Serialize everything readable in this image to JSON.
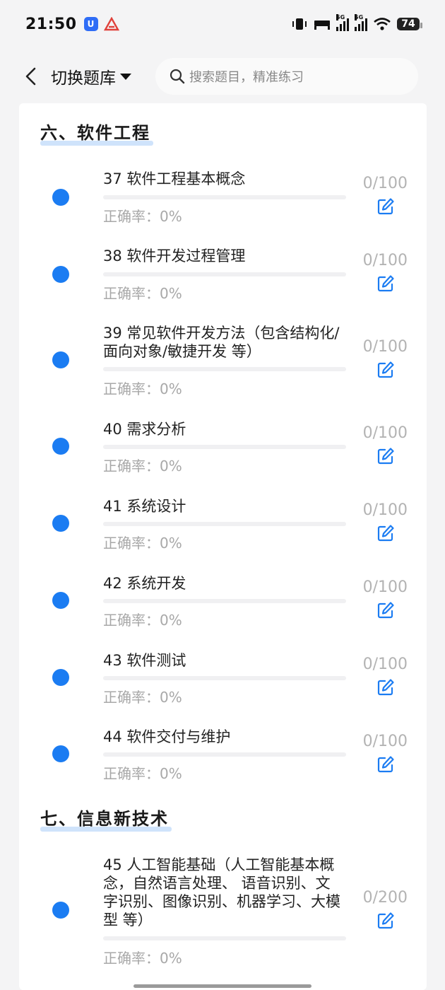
{
  "status": {
    "time": "21:50",
    "app_badge": "U",
    "network_1": "5G",
    "network_2": "5G",
    "battery": "74"
  },
  "header": {
    "bank_label": "切换题库",
    "search_placeholder": "搜索题目，精准练习"
  },
  "colors": {
    "accent": "#1b7cf2",
    "muted": "#a8a8a8",
    "highlight": "#cfe3fb"
  },
  "sections": [
    {
      "title": "六、软件工程",
      "items": [
        {
          "title": "37 软件工程基本概念",
          "accuracy": "正确率：0%",
          "score": "0/100"
        },
        {
          "title": "38 软件开发过程管理",
          "accuracy": "正确率：0%",
          "score": "0/100"
        },
        {
          "title": "39 常见软件开发方法（包含结构化/面向对象/敏捷开发 等）",
          "accuracy": "正确率：0%",
          "score": "0/100"
        },
        {
          "title": "40 需求分析",
          "accuracy": "正确率：0%",
          "score": "0/100"
        },
        {
          "title": "41 系统设计",
          "accuracy": "正确率：0%",
          "score": "0/100"
        },
        {
          "title": "42 系统开发",
          "accuracy": "正确率：0%",
          "score": "0/100"
        },
        {
          "title": "43 软件测试",
          "accuracy": "正确率：0%",
          "score": "0/100"
        },
        {
          "title": "44 软件交付与维护",
          "accuracy": "正确率：0%",
          "score": "0/100"
        }
      ]
    },
    {
      "title": "七、信息新技术",
      "items": [
        {
          "title": "45 人工智能基础（人工智能基本概念，自然语言处理、 语音识别、文字识别、图像识别、机器学习、大模型 等）",
          "accuracy": "正确率：0%",
          "score": "0/200"
        }
      ]
    }
  ]
}
